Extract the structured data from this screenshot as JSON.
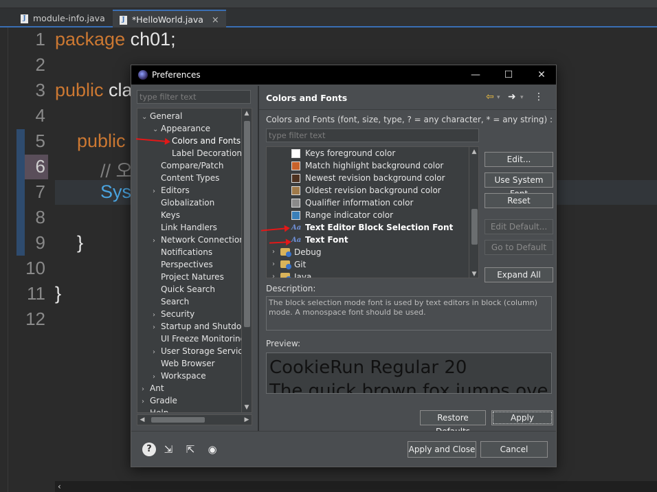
{
  "editor": {
    "tabs": [
      {
        "label": "module-info.java"
      },
      {
        "label": "*HelloWorld.java",
        "close": "×"
      }
    ],
    "line_numbers": [
      "1",
      "2",
      "3",
      "4",
      "5",
      "6",
      "7",
      "8",
      "9",
      "10",
      "11",
      "12"
    ],
    "code": {
      "l1_kw": "package",
      "l1_rest": " ch01;",
      "l3_kw": "public",
      "l3_rest": " cla",
      "l5_kw": "public",
      "l6": "// 오",
      "l7": "Sys",
      "l9": "}",
      "l11": "}"
    },
    "scroll_left": "‹"
  },
  "dialog": {
    "title": "Preferences",
    "window_buttons": {
      "minimize": "—",
      "maximize": "☐",
      "close": "✕"
    },
    "filter_placeholder": "type filter text",
    "tree": [
      {
        "label": "General",
        "arrow": "⌄",
        "depth": 0
      },
      {
        "label": "Appearance",
        "arrow": "⌄",
        "depth": 1
      },
      {
        "label": "Colors and Fonts",
        "arrow": "",
        "depth": 2
      },
      {
        "label": "Label Decorations",
        "arrow": "",
        "depth": 2
      },
      {
        "label": "Compare/Patch",
        "arrow": "",
        "depth": 1
      },
      {
        "label": "Content Types",
        "arrow": "",
        "depth": 1
      },
      {
        "label": "Editors",
        "arrow": "›",
        "depth": 1
      },
      {
        "label": "Globalization",
        "arrow": "",
        "depth": 1
      },
      {
        "label": "Keys",
        "arrow": "",
        "depth": 1
      },
      {
        "label": "Link Handlers",
        "arrow": "",
        "depth": 1
      },
      {
        "label": "Network Connections",
        "arrow": "›",
        "depth": 1
      },
      {
        "label": "Notifications",
        "arrow": "",
        "depth": 1
      },
      {
        "label": "Perspectives",
        "arrow": "",
        "depth": 1
      },
      {
        "label": "Project Natures",
        "arrow": "",
        "depth": 1
      },
      {
        "label": "Quick Search",
        "arrow": "",
        "depth": 1
      },
      {
        "label": "Search",
        "arrow": "",
        "depth": 1
      },
      {
        "label": "Security",
        "arrow": "›",
        "depth": 1
      },
      {
        "label": "Startup and Shutdown",
        "arrow": "›",
        "depth": 1
      },
      {
        "label": "UI Freeze Monitoring",
        "arrow": "",
        "depth": 1
      },
      {
        "label": "User Storage Service",
        "arrow": "›",
        "depth": 1
      },
      {
        "label": "Web Browser",
        "arrow": "",
        "depth": 1
      },
      {
        "label": "Workspace",
        "arrow": "›",
        "depth": 1
      },
      {
        "label": "Ant",
        "arrow": "›",
        "depth": 0
      },
      {
        "label": "Gradle",
        "arrow": "›",
        "depth": 0
      },
      {
        "label": "Help",
        "arrow": "›",
        "depth": 0
      }
    ],
    "page": {
      "title": "Colors and Fonts",
      "nav_back": "⇦",
      "nav_forward": "➜",
      "menu": "⋮",
      "description_top": "Colors and Fonts (font, size, type, ? = any character, * = any string) :",
      "filter_placeholder": "type filter text",
      "items": [
        {
          "label": "Keys foreground color",
          "kind": "color",
          "color": "#ffffff"
        },
        {
          "label": "Match highlight background color",
          "kind": "color",
          "color": "#c8622b"
        },
        {
          "label": "Newest revision background color",
          "kind": "color",
          "color": "#4e3220"
        },
        {
          "label": "Oldest revision background color",
          "kind": "color",
          "color": "#a07a4a"
        },
        {
          "label": "Qualifier information color",
          "kind": "color",
          "color": "#8a8a8a"
        },
        {
          "label": "Range indicator color",
          "kind": "color",
          "color": "#3a7fb8"
        },
        {
          "label": "Text Editor Block Selection Font",
          "kind": "font",
          "icon": "Aa"
        },
        {
          "label": "Text Font",
          "kind": "font",
          "icon": "Aa"
        },
        {
          "label": "Debug",
          "kind": "folder",
          "arrow": "›"
        },
        {
          "label": "Git",
          "kind": "folder",
          "arrow": "›"
        },
        {
          "label": "Java",
          "kind": "folder",
          "arrow": "›"
        }
      ],
      "buttons": {
        "edit": "Edit...",
        "use_system_font": "Use System Font",
        "reset": "Reset",
        "edit_default": "Edit Default...",
        "go_to_default": "Go to Default",
        "expand_all": "Expand All"
      },
      "description_label": "Description:",
      "description_text": "The block selection mode font is used by text editors in block (column) mode. A monospace font should be used.",
      "preview_label": "Preview:",
      "preview_line1": "CookieRun Regular 20",
      "preview_line2": "The quick brown fox jumps ove",
      "restore_defaults": "Restore Defaults",
      "apply": "Apply"
    },
    "bottom": {
      "help_icon": "?",
      "apply_and_close": "Apply and Close",
      "cancel": "Cancel"
    }
  }
}
